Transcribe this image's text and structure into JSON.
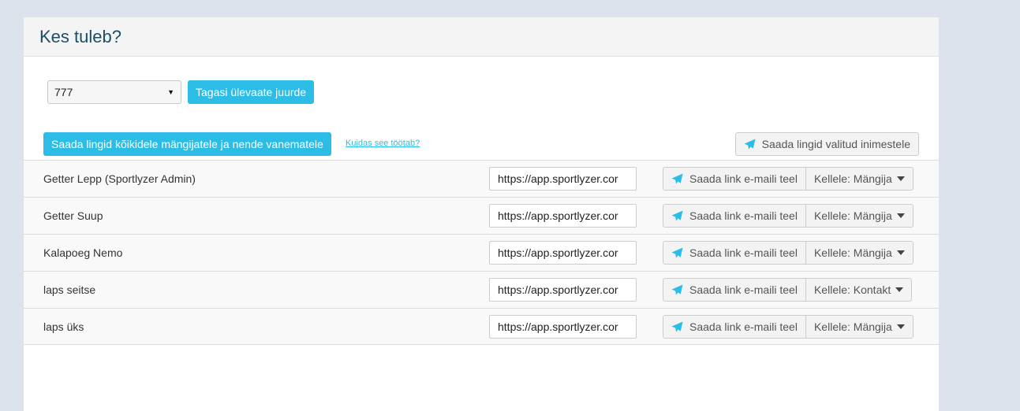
{
  "panel": {
    "title": "Kes tuleb?"
  },
  "topbar": {
    "selected_value": "777",
    "back_label": "Tagasi ülevaate juurde"
  },
  "actions": {
    "send_all_label": "Saada lingid kõikidele mängijatele ja nende vanematele",
    "how_link": "Kuidas see töötab?",
    "send_selected_label": "Saada lingid valitud inimestele"
  },
  "rows": [
    {
      "name": "Getter Lepp (Sportlyzer Admin)",
      "link": "https://app.sportlyzer.cor",
      "send_label": "Saada link e-maili teel",
      "recipient": "Kellele: Mängija"
    },
    {
      "name": "Getter Suup",
      "link": "https://app.sportlyzer.cor",
      "send_label": "Saada link e-maili teel",
      "recipient": "Kellele: Mängija"
    },
    {
      "name": "Kalapoeg Nemo",
      "link": "https://app.sportlyzer.cor",
      "send_label": "Saada link e-maili teel",
      "recipient": "Kellele: Mängija"
    },
    {
      "name": "laps seitse",
      "link": "https://app.sportlyzer.cor",
      "send_label": "Saada link e-maili teel",
      "recipient": "Kellele: Kontakt"
    },
    {
      "name": "laps üks",
      "link": "https://app.sportlyzer.cor",
      "send_label": "Saada link e-maili teel",
      "recipient": "Kellele: Mängija"
    }
  ],
  "colors": {
    "accent": "#2bbde6",
    "title": "#1b4d6b",
    "background": "#dde3ec"
  }
}
